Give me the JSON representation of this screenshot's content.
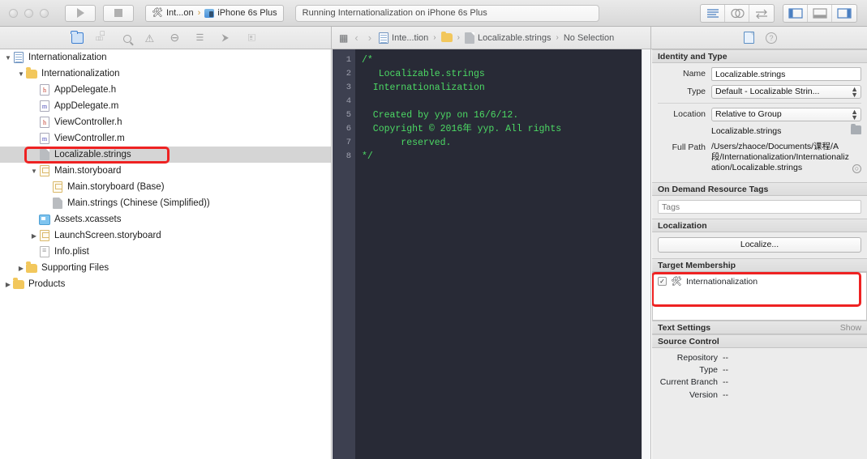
{
  "toolbar": {
    "run_label": "Run",
    "stop_label": "Stop",
    "scheme_name": "Int...on",
    "scheme_separator": "›",
    "destination": "iPhone 6s Plus",
    "status_text": "Running Internationalization on iPhone 6s Plus",
    "editor_buttons": [
      "standard-editor",
      "assistant-editor",
      "version-editor"
    ],
    "view_buttons": [
      "navigator-toggle",
      "debug-area-toggle",
      "utilities-toggle"
    ]
  },
  "navigator_filter": {
    "icons": [
      "project-navigator",
      "symbol-navigator",
      "find-navigator",
      "issue-navigator",
      "test-navigator",
      "debug-navigator",
      "breakpoint-navigator",
      "report-navigator"
    ],
    "active": "project-navigator"
  },
  "jumpbar": {
    "back_label": "‹",
    "forward_label": "›",
    "items": [
      "Inte...tion",
      "",
      "Localizable.strings",
      "No Selection"
    ],
    "separator": "›"
  },
  "inspector_tabs": {
    "icons": [
      "file-inspector",
      "quick-help-inspector"
    ],
    "active": "file-inspector"
  },
  "navigator": {
    "rows": [
      {
        "label": "Internationalization",
        "indent": 0,
        "disclosure": "down",
        "icon": "project-icon",
        "selected": false
      },
      {
        "label": "Internationalization",
        "indent": 1,
        "disclosure": "down",
        "icon": "folder-icon",
        "selected": false
      },
      {
        "label": "AppDelegate.h",
        "indent": 2,
        "disclosure": "none",
        "icon": "header-file-icon",
        "selected": false
      },
      {
        "label": "AppDelegate.m",
        "indent": 2,
        "disclosure": "none",
        "icon": "objc-file-icon",
        "selected": false
      },
      {
        "label": "ViewController.h",
        "indent": 2,
        "disclosure": "none",
        "icon": "header-file-icon",
        "selected": false
      },
      {
        "label": "ViewController.m",
        "indent": 2,
        "disclosure": "none",
        "icon": "objc-file-icon",
        "selected": false
      },
      {
        "label": "Localizable.strings",
        "indent": 2,
        "disclosure": "none",
        "icon": "strings-file-icon",
        "selected": true
      },
      {
        "label": "Main.storyboard",
        "indent": 2,
        "disclosure": "down",
        "icon": "storyboard-icon",
        "selected": false
      },
      {
        "label": "Main.storyboard (Base)",
        "indent": 3,
        "disclosure": "none",
        "icon": "storyboard-icon",
        "selected": false
      },
      {
        "label": "Main.strings (Chinese (Simplified))",
        "indent": 3,
        "disclosure": "none",
        "icon": "strings-file-icon",
        "selected": false
      },
      {
        "label": "Assets.xcassets",
        "indent": 2,
        "disclosure": "none",
        "icon": "assets-icon",
        "selected": false
      },
      {
        "label": "LaunchScreen.storyboard",
        "indent": 2,
        "disclosure": "right",
        "icon": "storyboard-icon",
        "selected": false
      },
      {
        "label": "Info.plist",
        "indent": 2,
        "disclosure": "none",
        "icon": "plist-icon",
        "selected": false
      },
      {
        "label": "Supporting Files",
        "indent": 1,
        "disclosure": "right",
        "icon": "folder-icon",
        "selected": false
      },
      {
        "label": "Products",
        "indent": 0,
        "disclosure": "right",
        "icon": "folder-icon",
        "selected": false
      }
    ]
  },
  "editor": {
    "line_numbers": [
      "1",
      "2",
      "3",
      "4",
      "5",
      "6",
      "7",
      "8"
    ],
    "lines": [
      "/*",
      "   Localizable.strings",
      "  Internationalization",
      "",
      "  Created by yyp on 16/6/12.",
      "  Copyright © 2016年 yyp. All rights",
      "       reserved.",
      "*/",
      ""
    ]
  },
  "inspector": {
    "identity": {
      "title": "Identity and Type",
      "name_label": "Name",
      "name_value": "Localizable.strings",
      "type_label": "Type",
      "type_value": "Default - Localizable Strin...",
      "location_label": "Location",
      "location_value": "Relative to Group",
      "location_file": "Localizable.strings",
      "fullpath_label": "Full Path",
      "fullpath_value": "/Users/zhaoce/Documents/课程/A段/Internationalization/Internationalization/Localizable.strings"
    },
    "ondemand": {
      "title": "On Demand Resource Tags",
      "tags_placeholder": "Tags",
      "tags_value": ""
    },
    "localization": {
      "title": "Localization",
      "localize_button": "Localize..."
    },
    "target_membership": {
      "title": "Target Membership",
      "items": [
        {
          "label": "Internationalization",
          "checked": true,
          "check_glyph": "✓"
        }
      ]
    },
    "text_settings": {
      "title": "Text Settings",
      "show_label": "Show"
    },
    "source_control": {
      "title": "Source Control",
      "rows": [
        {
          "label": "Repository",
          "value": "--"
        },
        {
          "label": "Type",
          "value": "--"
        },
        {
          "label": "Current Branch",
          "value": "--"
        },
        {
          "label": "Version",
          "value": "--"
        }
      ]
    }
  },
  "annotations": [
    {
      "name": "localizable-strings-highlight",
      "color": "#ee2222"
    },
    {
      "name": "localize-button-highlight",
      "color": "#ee2222"
    }
  ]
}
